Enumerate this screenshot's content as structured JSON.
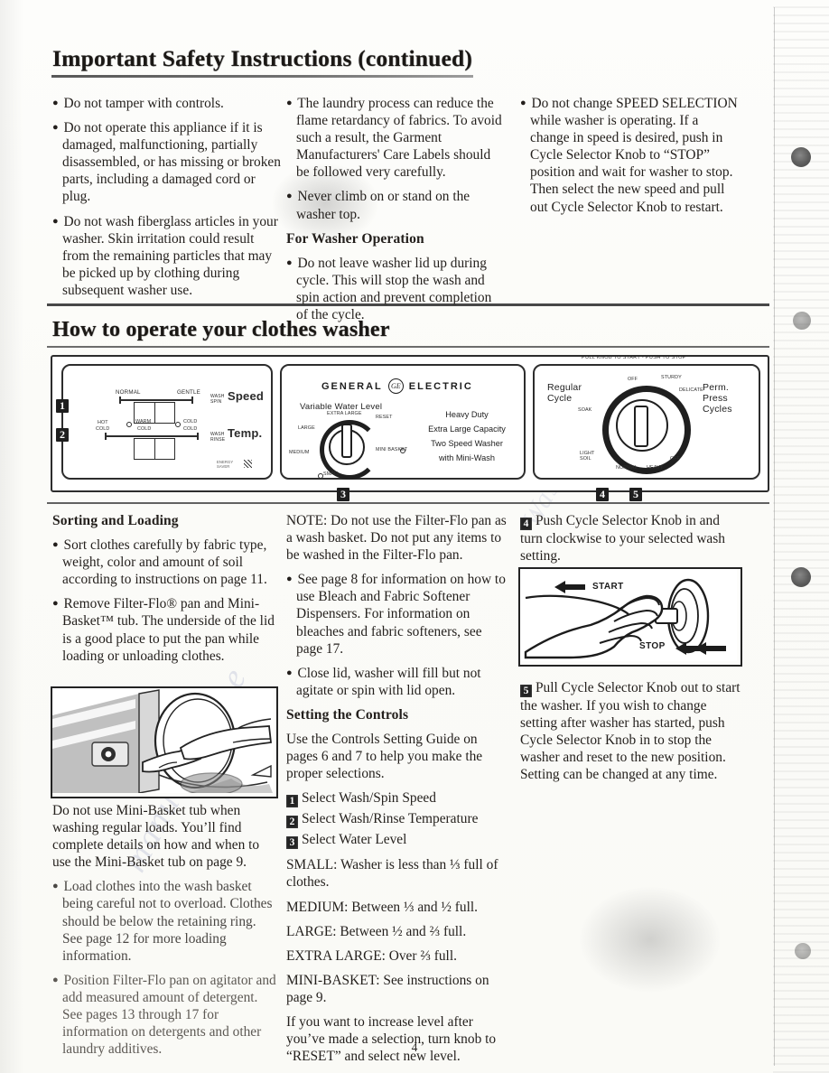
{
  "page": {
    "folio": "4",
    "safety_title": "Important Safety Instructions (continued)",
    "operate_title": "How to operate your clothes washer"
  },
  "watermarks": {
    "line1": "e.com",
    "line2": "manualsonline",
    "line3": "Washer"
  },
  "safety": {
    "col1": [
      "Do not tamper with controls.",
      "Do not operate this appliance if it is damaged, malfunctioning, partially disassembled, or has missing or broken parts, including a damaged cord or plug.",
      "Do not wash fiberglass articles in your washer. Skin irritation could result from the remaining particles that may be picked up by clothing during subsequent washer use."
    ],
    "col2": [
      "The laundry process can reduce the flame retardancy of fabrics. To avoid such a result, the Garment Manufacturers' Care Labels should be followed very carefully.",
      "Never climb on or stand on the washer top."
    ],
    "col2_subhead": "For Washer Operation",
    "col2_after": [
      "Do not leave washer lid up during cycle. This will stop the wash and spin action and prevent completion of the cycle."
    ],
    "col3": [
      "Do not change SPEED SELECTION while washer is operating. If a change in speed is desired, push in Cycle Selector Knob to “STOP” position and wait for washer to stop. Then select the new speed and pull out Cycle Selector Knob to restart."
    ]
  },
  "panel": {
    "left": {
      "speed_label": "Speed",
      "speed_sub": "WASH\nSPIN",
      "speed_options": [
        "NORMAL",
        "GENTLE"
      ],
      "temp_label": "Temp.",
      "temp_sub": "WASH\nRINSE",
      "temp_options": [
        "HOT\nCOLD",
        "WARM\nCOLD",
        "COLD\nCOLD"
      ],
      "corner_mark": "ENERGY\nSAVER"
    },
    "center": {
      "brand_left": "GENERAL",
      "brand_right": "ELECTRIC",
      "brand_monogram": "GE",
      "water_level_title": "Variable Water Level",
      "levels": [
        "EXTRA LARGE",
        "LARGE",
        "MEDIUM",
        "SMALL",
        "RESET",
        "MINI BASKET"
      ],
      "model_lines": [
        "Heavy Duty",
        "Extra Large Capacity",
        "Two Speed Washer",
        "with Mini-Wash"
      ]
    },
    "right": {
      "top_instruction": "PULL KNOB TO START - PUSH TO STOP",
      "left_group": "Regular\nCycle",
      "right_group": "Perm.\nPress\nCycles",
      "marks": [
        "OFF",
        "STURDY",
        "DELICATE",
        "SOAK",
        "LIGHT\nSOIL",
        "NORMAL",
        "HEAVY",
        "OFF"
      ]
    },
    "step_tags": [
      "1",
      "2",
      "3",
      "4",
      "5"
    ]
  },
  "left_column": {
    "heading": "Sorting and Loading",
    "bullets": [
      "Sort clothes carefully by fabric type, weight, color and amount of soil according to instructions on page 11.",
      "Remove Filter-Flo® pan and Mini-Basket™ tub. The underside of the lid is a good place to put the pan while loading or unloading clothes."
    ],
    "photo_caption": "Do not use Mini-Basket tub when washing regular loads. You’ll find complete details on how and when to use the Mini-Basket tub on page 9.",
    "bullets_after": [
      "Load clothes into the wash basket being careful not to overload. Clothes should be below the retaining ring. See page 12 for more loading information.",
      "Position Filter-Flo pan on agitator and add measured amount of detergent. See pages 13 through 17 for information on detergents and other laundry additives."
    ]
  },
  "middle_column": {
    "note": "NOTE: Do not use the Filter-Flo pan as a wash basket. Do not put any items to be washed in the Filter-Flo pan.",
    "bullets": [
      "See page 8 for information on how to use Bleach and Fabric Softener Dispensers. For information on bleaches and fabric softeners, see page 17.",
      "Close lid, washer will fill but not agitate or spin with lid open."
    ],
    "heading": "Setting the Controls",
    "intro": "Use the Controls Setting Guide on pages 6 and 7 to help you make the proper selections.",
    "steps": [
      {
        "num": "1",
        "text": "Select Wash/Spin Speed"
      },
      {
        "num": "2",
        "text": "Select Wash/Rinse Temperature"
      },
      {
        "num": "3",
        "text": "Select Water Level"
      }
    ],
    "levels": [
      "SMALL: Washer is less than ⅓ full of clothes.",
      "MEDIUM: Between ⅓ and ½ full.",
      "LARGE: Between ½ and ⅔ full.",
      "EXTRA LARGE: Over ⅔ full.",
      "MINI-BASKET: See instructions on page 9."
    ],
    "closing": "If you want to increase level after you’ve made a selection, turn knob to “RESET” and select new level."
  },
  "right_column": {
    "step4": {
      "num": "4",
      "text": "Push Cycle Selector Knob in and turn clockwise to your selected wash setting."
    },
    "photo_labels": {
      "start": "START",
      "stop": "STOP"
    },
    "step5": {
      "num": "5",
      "text": "Pull Cycle Selector Knob out to start the washer. If you wish to change setting after washer has started, push Cycle Selector Knob in to stop the washer and reset to the new position. Setting can be changed at any time."
    }
  }
}
